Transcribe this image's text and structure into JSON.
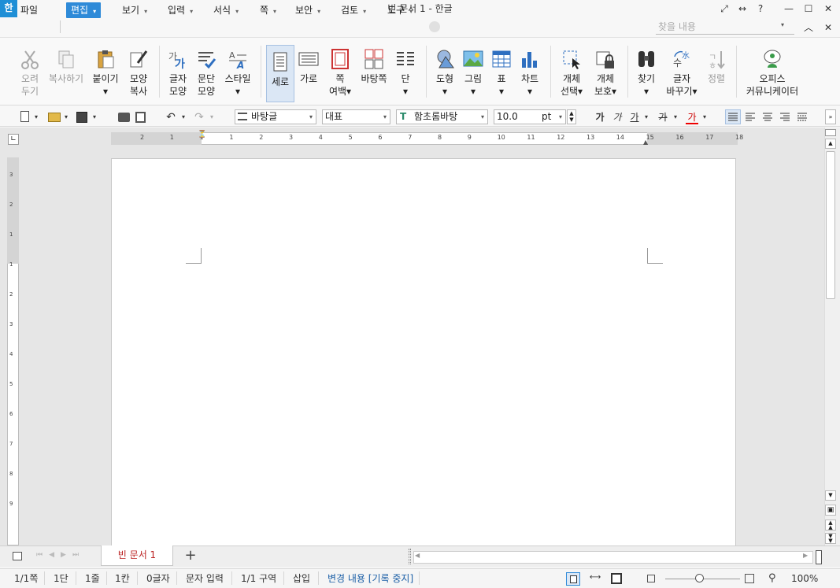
{
  "window": {
    "app_icon": "한",
    "title": "빈 문서 1 - 한글",
    "ctrl_help": "?",
    "ctrl_min": "—",
    "ctrl_max": "☐",
    "ctrl_close": "✕"
  },
  "menu": {
    "items": [
      "파일",
      "편집",
      "보기",
      "입력",
      "서식",
      "쪽",
      "보안",
      "검토",
      "도구"
    ],
    "find_placeholder": "찾을 내용",
    "collapse": "︿",
    "close": "✕"
  },
  "ribbon": {
    "cut": "오려\n두기",
    "copy": "복사하기",
    "paste": "붙이기\n▾",
    "format_copy": "모양\n복사",
    "char_shape": "글자\n모양",
    "para_shape": "문단\n모양",
    "style": "스타일\n▾",
    "portrait": "세로",
    "landscape": "가로",
    "page_margin": "쪽\n여백▾",
    "background": "바탕쪽",
    "column": "단\n▾",
    "shape": "도형\n▾",
    "picture": "그림\n▾",
    "table": "표\n▾",
    "chart": "차트\n▾",
    "object_select": "개체\n선택▾",
    "object_protect": "개체\n보호▾",
    "find": "찾기\n▾",
    "replace": "글자\n바꾸기▾",
    "sort": "정렬",
    "office_communicator": "오피스\n커뮤니케이터"
  },
  "toolbar": {
    "style_name": "바탕글",
    "language": "대표",
    "font": "함초롬바탕",
    "font_size": "10.0",
    "font_unit": "pt",
    "bold": "가",
    "italic": "가",
    "underline": "가",
    "strike": "가",
    "color": "가"
  },
  "ruler": {
    "h_ticks": [
      "2",
      "1",
      "1",
      "1",
      "2",
      "3",
      "4",
      "5",
      "6",
      "7",
      "8",
      "9",
      "10",
      "11",
      "12",
      "13",
      "14",
      "15",
      "16",
      "17",
      "18"
    ],
    "v_ticks": [
      "3",
      "2",
      "1",
      "1",
      "2",
      "3",
      "4",
      "5",
      "6",
      "7",
      "8",
      "9"
    ]
  },
  "tabs": {
    "doc": "빈 문서 1",
    "add": "+"
  },
  "status": {
    "page": "1/1쪽",
    "column": "1단",
    "line": "1줄",
    "char_col": "1칸",
    "char_count": "0글자",
    "input_mode": "문자 입력",
    "section": "1/1 구역",
    "insert_mode": "삽입",
    "track_changes": "변경 내용 [기록 중지]",
    "zoom": "100%"
  },
  "colors": {
    "accent": "#2e8ad8",
    "page": "#ffffff",
    "workspace": "#e6e6e6"
  }
}
